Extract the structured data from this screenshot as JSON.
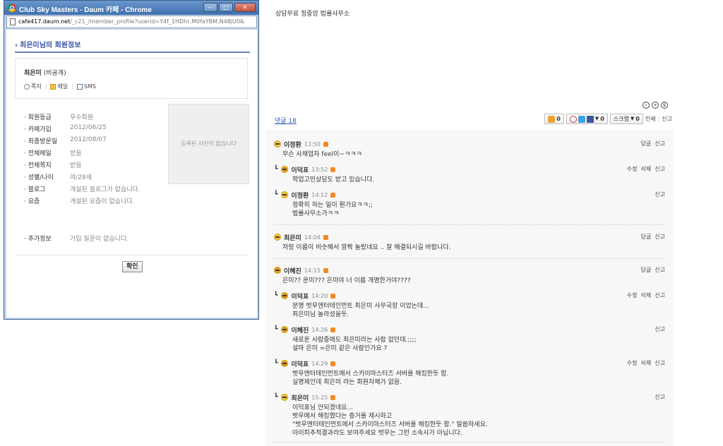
{
  "article": {
    "ad_text": "상담무료  정중앙 법률사무소",
    "top_icons": [
      "i",
      "+",
      "$"
    ]
  },
  "comment_bar": {
    "count_label": "댓글 18",
    "like_count": "0",
    "share_count": "0",
    "scrap_label": "스크랩",
    "scrap_count": "0",
    "print_label": "인쇄",
    "report_label": "신고"
  },
  "comments": [
    {
      "reply": false,
      "name": "이정환",
      "time": "13:50",
      "body": "무슨 사채업자 feel이~ㅋㅋㅋ",
      "actions": [
        "답글",
        "신고"
      ]
    },
    {
      "reply": true,
      "name": "이덕표",
      "time": "13:52",
      "body": "학업고민상담도 받고 있습니다.",
      "actions": [
        "수정",
        "삭제",
        "신고"
      ]
    },
    {
      "reply": true,
      "name": "이정환",
      "time": "14:12",
      "body": "정확히 하는 일이 뭔가요ㅋㅋ;;\n법률사무소가ㅋㅋ",
      "actions": [
        "신고"
      ]
    },
    {
      "reply": false,
      "name": "최은미",
      "time": "14:04",
      "body": "저랑 이름이 비슷해서 깜짝 놀랐네요 .. 잘 해결되시길 바랍니다.",
      "actions": [
        "답글",
        "신고"
      ]
    },
    {
      "reply": false,
      "name": "이혜진",
      "time": "14:15",
      "body": "은미?? 운미??? 은미야 너 이름 개명한거야????",
      "actions": [
        "답글",
        "신고"
      ]
    },
    {
      "reply": true,
      "name": "이덕표",
      "time": "14:20",
      "body": "분명 벗우엔터테인먼트 최은미 사무국장 이었는데...\n최은미님 놀라셨을듯.",
      "actions": [
        "수정",
        "삭제",
        "신고"
      ]
    },
    {
      "reply": true,
      "name": "이혜진",
      "time": "14:26",
      "body": "새로운 사람중에도 최은미라는 사람 없던데.;;;;\n설마 은미 =은미 같은 사람인가요 ?",
      "actions": [
        "신고"
      ]
    },
    {
      "reply": true,
      "name": "이덕표",
      "time": "14:29",
      "body": "벗우엔터테인먼트에서 스카이마스터즈 서버를 해킹한듯 함.\n실명제인데 최은미 라는 회원자체가 없음.",
      "actions": [
        "수정",
        "삭제",
        "신고"
      ]
    },
    {
      "reply": true,
      "name": "최은미",
      "time": "15:25",
      "body": "이덕표님 안되겠네요...\n벗우에서 해킹했다는 증거를 제시하고\n\"벗우엔터테인먼트에서 스카이마스터즈 서버를 해킹한듯 함.\" 말씀하세요.\n아이피추적결과라도 보여주세요 벗우는 그런 소속사가 아닙니다.",
      "actions": [
        "신고"
      ]
    }
  ],
  "popup": {
    "window_title": "Club Sky Masters - Daum 카페 - Chrome",
    "win_buttons": [
      "—",
      "□",
      "✕"
    ],
    "url_domain": "cafe417.daum.net",
    "url_rest": "/_c21_/member_profile?userid=Y4f_1HDhr,M0faYBM,N48jU0&",
    "profile_title": "최은미님의 회원정보",
    "user_name": "최은미",
    "user_status": "(비공개)",
    "links": {
      "note": "쪽지",
      "mail": "메일",
      "sms": "SMS"
    },
    "info": [
      {
        "k": "회원등급",
        "v": "우수회원"
      },
      {
        "k": "카페가입",
        "v": "2012/06/25"
      },
      {
        "k": "최종방문일",
        "v": "2012/08/07"
      },
      {
        "k": "전체메일",
        "v": "받음"
      },
      {
        "k": "전체쪽지",
        "v": "받음"
      },
      {
        "k": "성별/나이",
        "v": "여/28세"
      },
      {
        "k": "블로그",
        "v": "개설된 블로그가 없습니다."
      },
      {
        "k": "요즘",
        "v": "개설된 요즘이 없습니다."
      },
      {
        "k": "추가정보",
        "v": "가입 질문이 없습니다."
      }
    ],
    "photo_text": "등록된 사진이 없습니다",
    "ok_label": "확인"
  }
}
